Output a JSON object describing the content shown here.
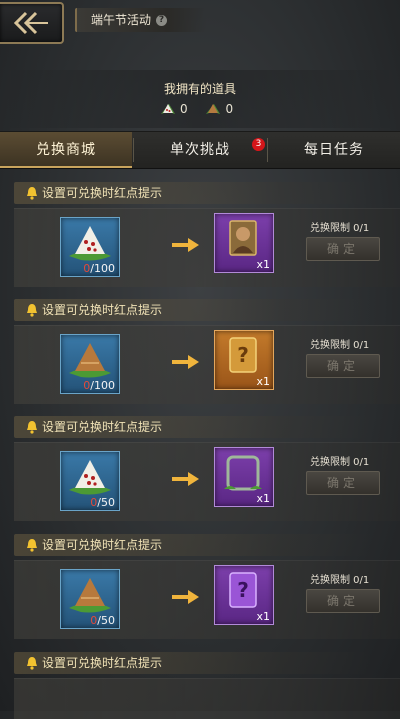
{
  "header": {
    "title": "端午节活动",
    "help_icon": "question-icon",
    "back_icon": "back-arrow-icon"
  },
  "owned": {
    "title": "我拥有的道具",
    "items": [
      {
        "icon": "white-zongzi-icon",
        "count": "0"
      },
      {
        "icon": "brown-zongzi-icon",
        "count": "0"
      }
    ]
  },
  "tabs": [
    {
      "label": "兑换商城",
      "active": true
    },
    {
      "label": "单次挑战",
      "badge": "3"
    },
    {
      "label": "每日任务"
    }
  ],
  "exchange": {
    "hint": "设置可兑换时红点提示",
    "limit_label": "兑换限制 0/1",
    "confirm_label": "确定",
    "rows": [
      {
        "cost_icon": "white-zongzi-icon",
        "have": "0",
        "need": "/100",
        "reward_icon": "hero-card-icon",
        "qty": "x1"
      },
      {
        "cost_icon": "brown-zongzi-icon",
        "have": "0",
        "need": "/100",
        "reward_icon": "mystery-card-icon",
        "qty": "x1"
      },
      {
        "cost_icon": "white-zongzi-icon",
        "have": "0",
        "need": "/50",
        "reward_icon": "avatar-frame-icon",
        "qty": "x1"
      },
      {
        "cost_icon": "brown-zongzi-icon",
        "have": "0",
        "need": "/50",
        "reward_icon": "purple-mystery-card-icon",
        "qty": "x1"
      }
    ]
  },
  "colors": {
    "accent": "#c9a45d",
    "badge": "#d4161a",
    "cost_deficit": "#e24a3a"
  }
}
